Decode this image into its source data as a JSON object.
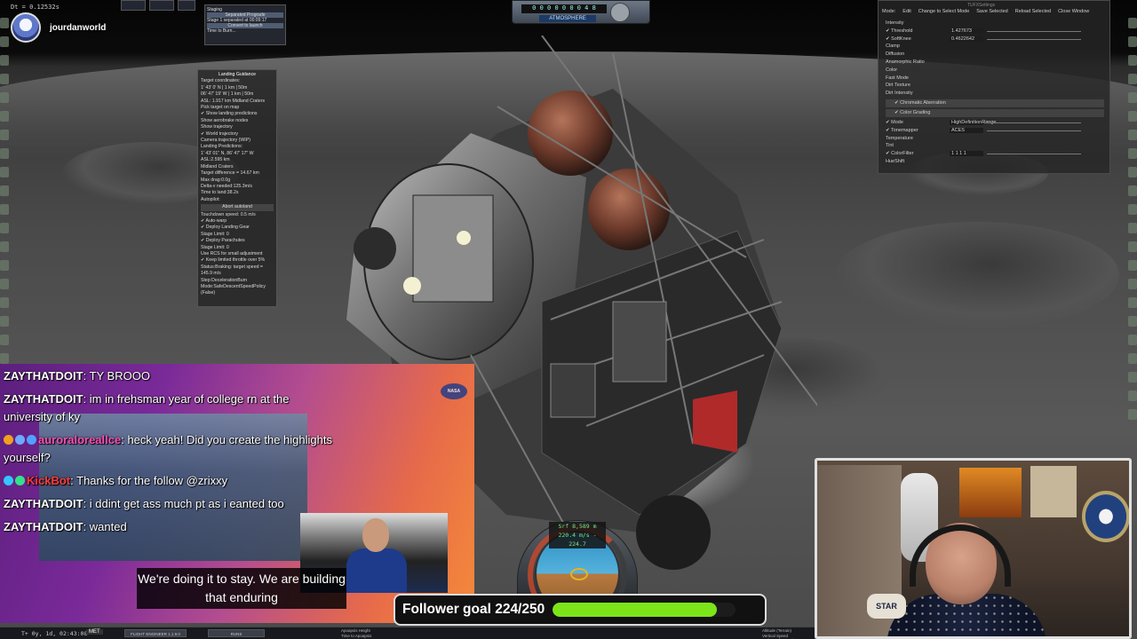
{
  "streamer": {
    "name": "jourdanworld"
  },
  "hud_top": {
    "delta_time": "Dt = 0.12532s",
    "altitude_digits": "0 0 0 0 0 0 0 4 8",
    "atmosphere_label": "ATMOSPHERE"
  },
  "small_window": {
    "lines": [
      "Staging",
      "Separated Prograde",
      "Stage 1 separated at 00:09:17",
      "Time to Burn..."
    ],
    "button": "Separated Prograde",
    "button2": "Convert to launch"
  },
  "mechjeb": {
    "title": "Landing Guidance",
    "lines": [
      "Target coordinates:",
      "1' 43' 0' N  | 1 km  | 50m",
      "06' 47' 19' W | 1 km | 50m",
      "ASL: 1.917 km  Midland Craters",
      "Pick target on map",
      "✔ Show landing predictions",
      "  Show aerobrake nodes",
      "  Show trajectory",
      "✔ World trajectory",
      "  Camera trajectory (WIP)",
      "Landing Predictions:",
      "1' 43' 01\" N, 86' 47' 17\" W",
      "ASL:2.595 km",
      "Midland Craters",
      "Target difference = 14.67 km",
      "Max drag:0.0g",
      "Delta-v needed:125.3m/s",
      "Time to land:38.2s",
      "Autopilot:"
    ],
    "abort_button": "Abort autoland",
    "lines2": [
      "Touchdown speed:   0.5 m/s",
      "✔ Auto-warp",
      "✔ Deploy Landing Gear",
      "Stage Limit:              0",
      "✔ Deploy Parachutes",
      "Stage Limit:              0",
      "  Use RCS for small adjustment",
      "✔ Keep limited throttle over 5%",
      "Status:Braking: target speed =",
      "145.9 m/s",
      "Step:DecelerationBurn",
      "Mode:SafeDescentSpeedPolicy",
      "(False)"
    ]
  },
  "pp_panel": {
    "title": "TUFXSettings",
    "menu": [
      "Mode:",
      "Edit",
      "Change to Select Mode",
      "Save Selected",
      "Reload Selected",
      "Close Window"
    ],
    "rows": [
      {
        "label": "Intensity",
        "value": ""
      },
      {
        "label": "✔ Threshold",
        "value": "1.427673"
      },
      {
        "label": "✔ SoftKnee",
        "value": "0.4622642"
      },
      {
        "label": "Clamp",
        "value": ""
      },
      {
        "label": "Diffusion",
        "value": ""
      },
      {
        "label": "Anamorphic Ratio",
        "value": ""
      },
      {
        "label": "Color",
        "value": ""
      },
      {
        "label": "Fast Mode",
        "value": ""
      },
      {
        "label": "Dirt Texture",
        "value": ""
      },
      {
        "label": "Dirt Intensity",
        "value": ""
      }
    ],
    "section1": "✔  Chromatic Aberration",
    "section2": "✔  Color Grading",
    "rows2": [
      {
        "label": "✔ Mode",
        "value": "HighDefinitionRange"
      },
      {
        "label": "✔ Tonemapper",
        "value": "ACES"
      },
      {
        "label": "Temperature",
        "value": ""
      },
      {
        "label": "Tint",
        "value": ""
      },
      {
        "label": "✔ ColorFilter",
        "value": "1  1  1  1"
      },
      {
        "label": "HueShift",
        "value": ""
      }
    ]
  },
  "chat": [
    {
      "user": "ZAYTHATDOIT",
      "user_color": "#ffffff",
      "text": "TY BROOO",
      "badges": []
    },
    {
      "user": "ZAYTHATDOIT",
      "user_color": "#ffffff",
      "text": "im in frehsman year of college rn at the university of ky",
      "badges": []
    },
    {
      "user": "auroraloreallce",
      "user_color": "#ff4fb8",
      "text": "heck yeah! Did you create the highlights yourself?",
      "badges": [
        "#f0a020",
        "#6fa8ff",
        "#4fa3ff"
      ]
    },
    {
      "user": "KickBot",
      "user_color": "#ff3b3b",
      "text": "Thanks for the follow @zrixxy",
      "badges": [
        "#35c6ff",
        "#35e08a"
      ]
    },
    {
      "user": "ZAYTHATDOIT",
      "user_color": "#ffffff",
      "text": "i ddint get ass much pt as i eanted too",
      "badges": []
    },
    {
      "user": "ZAYTHATDOIT",
      "user_color": "#ffffff",
      "text": "wanted",
      "badges": []
    }
  ],
  "nasa_logo": "NASA",
  "subtitles": "We're doing it to stay. We are building that enduring",
  "navball": {
    "surface": "Srf 8,589 m",
    "speed": "220.4 m/s - 224.7"
  },
  "follower_goal": {
    "label": "Follower goal 224/250",
    "current": 224,
    "target": 250
  },
  "bottom_bar": {
    "met": "T+ 0y, 1d, 02:43:08",
    "met_label": "MET",
    "stage_labels": [
      "FLIGHT ENGINEER 1.1.9.0",
      "RUNS"
    ],
    "info_left": "Apoapsis Height\nTime to Apoapsis\nPeriapsis Apsis",
    "info_right": "Altitude (Terrain)\nVertical Speed\nHorizontal Speed"
  },
  "webcam": {
    "shirt_tag": "STAR"
  }
}
